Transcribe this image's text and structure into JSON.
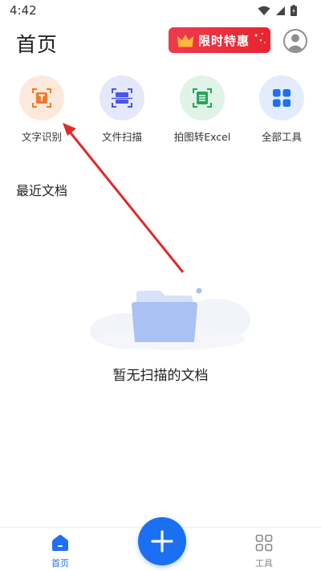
{
  "status_bar": {
    "time": "4:42"
  },
  "header": {
    "title": "首页",
    "promo_label": "限时特惠"
  },
  "tools": [
    {
      "label": "文字识别",
      "icon": "text-recognition-icon",
      "color": "#f07a2a",
      "bg": "#fde9dc"
    },
    {
      "label": "文件扫描",
      "icon": "file-scan-icon",
      "color": "#4a57e8",
      "bg": "#e5e7fb"
    },
    {
      "label": "拍图转Excel",
      "icon": "excel-convert-icon",
      "color": "#26a65b",
      "bg": "#dff3e6"
    },
    {
      "label": "全部工具",
      "icon": "all-tools-icon",
      "color": "#1e6ff5",
      "bg": "#e2ecfd"
    }
  ],
  "recent": {
    "title": "最近文档",
    "empty_text": "暂无扫描的文档"
  },
  "bottom_nav": {
    "home_label": "首页",
    "tools_label": "工具"
  },
  "colors": {
    "accent": "#1b6ff2",
    "promo": "#e8242f",
    "annotation_arrow": "#e02a2a"
  }
}
